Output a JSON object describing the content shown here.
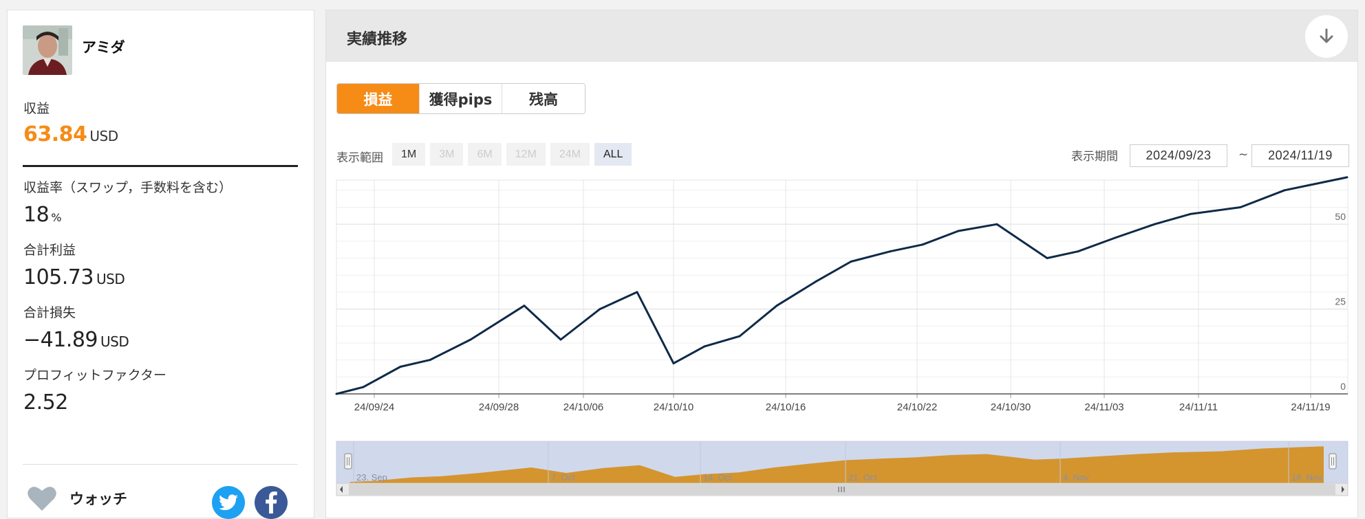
{
  "profile": {
    "name": "アミダ",
    "profit_label": "収益",
    "profit_value": "63.84",
    "profit_unit": "USD",
    "rate_label": "収益率（スワップ，手数料を含む）",
    "rate_value": "18",
    "rate_unit": "%",
    "total_profit_label": "合計利益",
    "total_profit_value": "105.73",
    "total_profit_unit": "USD",
    "total_loss_label": "合計損失",
    "total_loss_value": "−41.89",
    "total_loss_unit": "USD",
    "pf_label": "プロフィットファクター",
    "pf_value": "2.52",
    "watch_label": "ウォッチ"
  },
  "panel": {
    "title": "実績推移",
    "tabs": [
      {
        "label": "損益",
        "active": true
      },
      {
        "label": "獲得pips",
        "active": false
      },
      {
        "label": "残高",
        "active": false
      }
    ],
    "range_label": "表示範囲",
    "range_buttons": [
      {
        "label": "1M",
        "state": "enabled"
      },
      {
        "label": "3M",
        "state": "disabled"
      },
      {
        "label": "6M",
        "state": "disabled"
      },
      {
        "label": "12M",
        "state": "disabled"
      },
      {
        "label": "24M",
        "state": "disabled"
      },
      {
        "label": "ALL",
        "state": "selected"
      }
    ],
    "period_label": "表示期間",
    "date_from": "2024/09/23",
    "date_sep": "~",
    "date_to": "2024/11/19"
  },
  "colors": {
    "accent": "#f68b16",
    "line": "#0f2a47",
    "navigator_area": "#d4952f",
    "navigator_bg": "#d0d8ec",
    "twitter": "#1da1f2",
    "facebook": "#3b5998"
  },
  "icons": {
    "download": "arrow-down-icon",
    "watch": "heart-icon",
    "twitter": "twitter-icon",
    "facebook": "facebook-icon"
  },
  "chart_data": {
    "type": "line",
    "x_ticks": [
      "24/09/24",
      "24/09/28",
      "24/10/06",
      "24/10/10",
      "24/10/16",
      "24/10/22",
      "24/10/30",
      "24/11/03",
      "24/11/11",
      "24/11/19"
    ],
    "y_ticks": [
      0,
      25,
      50
    ],
    "ylim": [
      0,
      63
    ],
    "grid": true,
    "series": [
      {
        "values": [
          0,
          2,
          8,
          10,
          16,
          26,
          16,
          25,
          30,
          9,
          14,
          17,
          26,
          33,
          39,
          42,
          44,
          48,
          50,
          40,
          42,
          46,
          50,
          53,
          55,
          60,
          63.84
        ]
      }
    ],
    "navigator": {
      "labels": [
        "23. Sep",
        "7. Oct",
        "14. Oct",
        "21. Oct",
        "4. Nov",
        "18. Nov"
      ]
    }
  }
}
